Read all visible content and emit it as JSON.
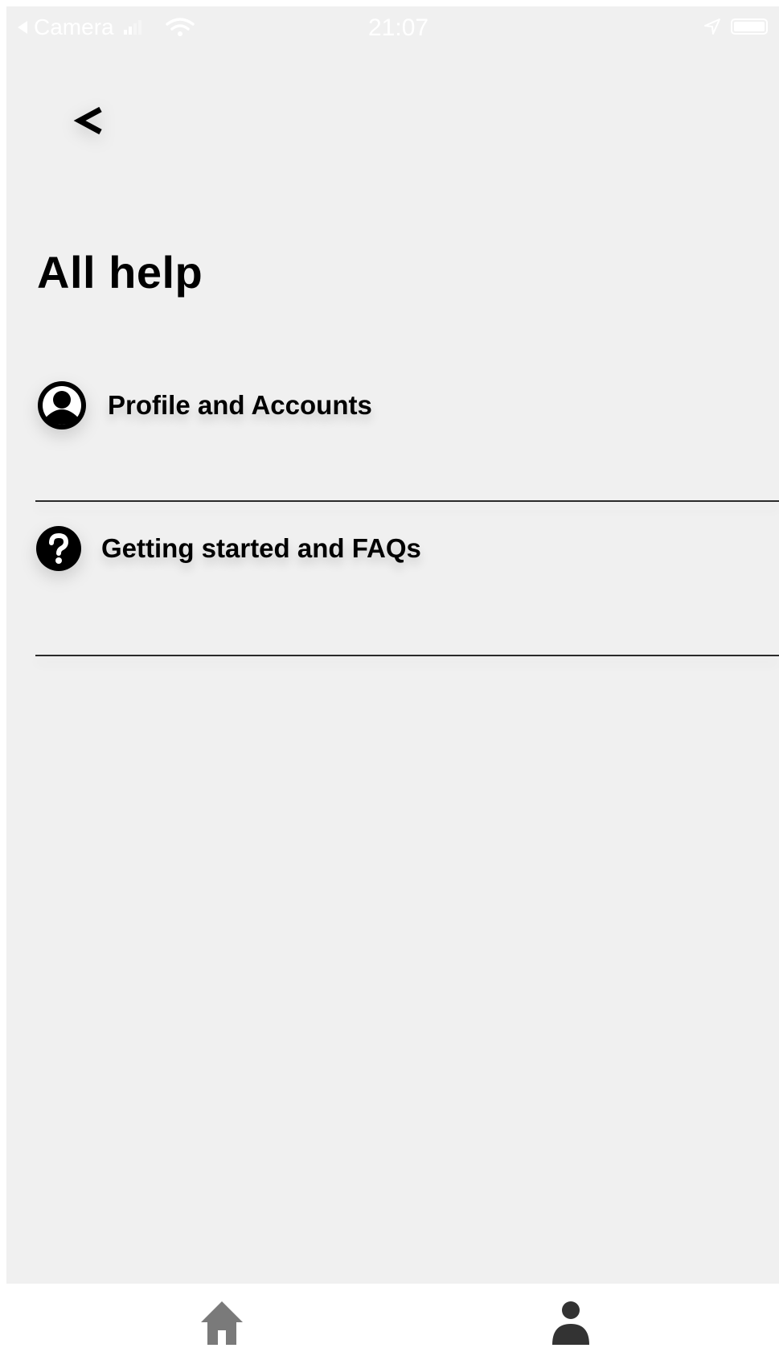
{
  "status_bar": {
    "back_app": "Camera",
    "time": "21:07"
  },
  "header": {
    "back_label": "<",
    "title": "All help"
  },
  "help_items": [
    {
      "label": "Profile and Accounts",
      "icon": "account-circle-icon"
    },
    {
      "label": "Getting started and FAQs",
      "icon": "help-circle-icon"
    }
  ],
  "tab_bar": {
    "tabs": [
      {
        "icon": "home-icon",
        "color": "#7a7a7a"
      },
      {
        "icon": "person-icon",
        "color": "#333333"
      }
    ]
  },
  "colors": {
    "background": "#f0f0f0",
    "text": "#000000",
    "divider": "#2a2a2a",
    "tab_bar": "#ffffff"
  }
}
